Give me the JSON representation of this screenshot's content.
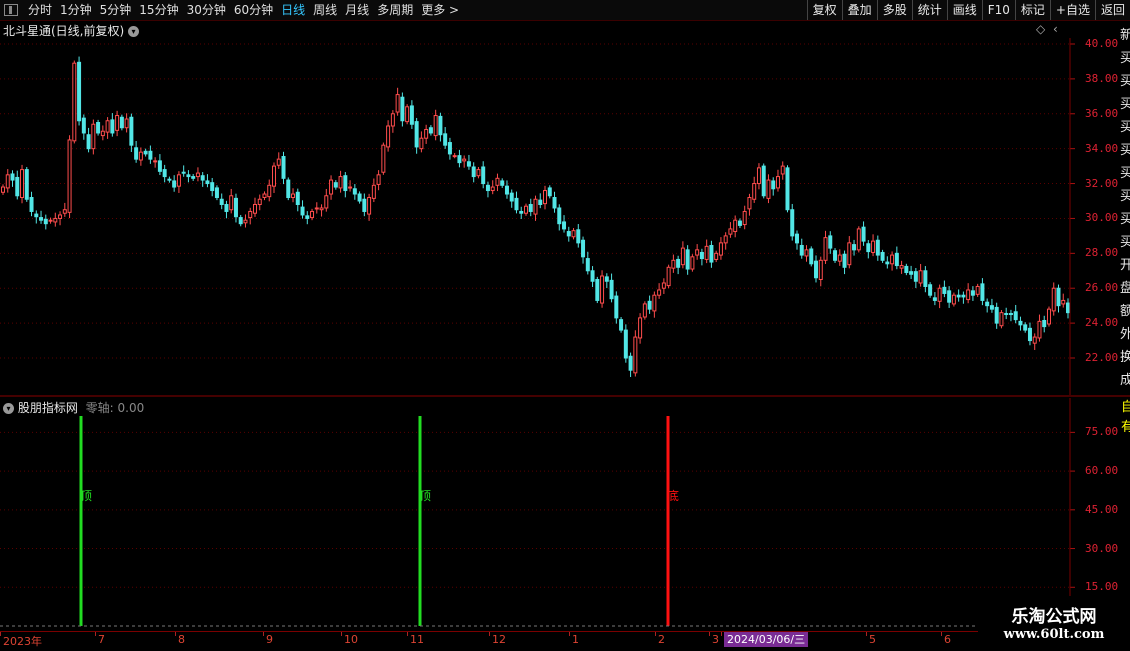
{
  "toolbar": {
    "periods": [
      "分时",
      "1分钟",
      "5分钟",
      "15分钟",
      "30分钟",
      "60分钟",
      "日线",
      "周线",
      "月线",
      "多周期",
      "更多 >"
    ],
    "active_period": "日线",
    "right_buttons": [
      "复权",
      "叠加",
      "多股",
      "统计",
      "画线",
      "F10",
      "标记",
      "+自选",
      "返回"
    ]
  },
  "main_chart": {
    "title": "北斗星通(日线,前复权)",
    "y_ticks": [
      "40.00",
      "38.00",
      "36.00",
      "34.00",
      "32.00",
      "30.00",
      "28.00",
      "26.00",
      "24.00",
      "22.00"
    ]
  },
  "indicator": {
    "title": "股朋指标网",
    "zero_axis": "零轴: 0.00",
    "y_ticks": [
      "75.00",
      "60.00",
      "45.00",
      "30.00",
      "15.00"
    ],
    "signals": [
      {
        "label": "顶",
        "color": "#22dd22"
      },
      {
        "label": "顶",
        "color": "#22dd22"
      },
      {
        "label": "底",
        "color": "#ff1111"
      }
    ]
  },
  "date_axis": {
    "labels": [
      "2023年",
      "7",
      "8",
      "9",
      "10",
      "11",
      "12",
      "1",
      "2",
      "3",
      "2024/03/06/三",
      "5",
      "6"
    ],
    "highlight": "2024/03/06/三"
  },
  "watermark": {
    "title": "乐淘公式网",
    "url": "www.60lt.com"
  },
  "side_panel_text": "新\n买\n买\n买\n买\n买\n买\n买\n买\n买\n开\n盘\n额\n外\n换\n成",
  "side_panel_text2": "自\n有",
  "chart_data": {
    "type": "candlestick",
    "title": "北斗星通(日线,前复权)",
    "ylim": [
      20.5,
      40.5
    ],
    "up_color": "#ff4d4d",
    "down_color": "#52e6e6",
    "closes": [
      31.8,
      32.5,
      32.2,
      31.3,
      32.8,
      31.1,
      30.4,
      30.1,
      29.9,
      29.7,
      29.9,
      30.0,
      30.2,
      30.5,
      34.5,
      38.9,
      35.6,
      34.9,
      34.0,
      35.4,
      34.9,
      35.0,
      35.6,
      34.9,
      35.9,
      35.2,
      35.7,
      34.2,
      33.4,
      33.8,
      33.7,
      33.4,
      33.3,
      32.7,
      32.4,
      32.2,
      31.8,
      32.5,
      32.6,
      32.4,
      32.3,
      32.6,
      32.2,
      32.0,
      31.6,
      31.2,
      30.8,
      30.4,
      31.3,
      30.1,
      29.7,
      29.9,
      30.4,
      30.8,
      31.1,
      31.4,
      31.9,
      33.0,
      33.4,
      32.3,
      31.2,
      31.4,
      30.8,
      30.2,
      30.0,
      30.4,
      30.6,
      30.6,
      31.3,
      32.2,
      31.8,
      32.4,
      31.6,
      31.8,
      31.4,
      31.0,
      30.4,
      31.2,
      31.9,
      32.5,
      34.2,
      35.3,
      36.0,
      37.1,
      35.6,
      36.4,
      35.4,
      34.1,
      34.6,
      35.1,
      34.9,
      35.9,
      34.8,
      34.2,
      33.7,
      33.6,
      33.2,
      33.4,
      33.0,
      32.4,
      32.8,
      32.0,
      31.6,
      31.8,
      32.3,
      31.9,
      31.4,
      31.0,
      30.5,
      30.3,
      30.7,
      30.4,
      31.1,
      30.8,
      31.6,
      31.3,
      30.6,
      29.7,
      29.4,
      29.0,
      29.3,
      28.6,
      27.8,
      27.0,
      26.4,
      25.3,
      26.7,
      26.4,
      25.4,
      24.3,
      23.6,
      22.0,
      21.3,
      23.2,
      24.3,
      25.1,
      24.8,
      25.6,
      25.9,
      26.3,
      27.2,
      27.6,
      27.2,
      28.3,
      27.1,
      27.8,
      28.2,
      27.7,
      28.4,
      27.5,
      28.0,
      28.6,
      29.0,
      29.4,
      29.9,
      29.6,
      30.4,
      31.2,
      32.0,
      32.9,
      31.3,
      32.2,
      31.7,
      32.4,
      33.0,
      30.5,
      29.0,
      28.6,
      27.9,
      28.2,
      27.4,
      26.6,
      27.6,
      28.9,
      28.3,
      27.6,
      27.9,
      27.2,
      28.6,
      28.2,
      29.4,
      28.7,
      28.1,
      28.7,
      27.9,
      27.6,
      27.4,
      27.9,
      27.3,
      27.3,
      26.9,
      26.8,
      26.4,
      27.0,
      26.1,
      25.6,
      25.3,
      26.0,
      25.7,
      25.2,
      25.6,
      25.5,
      25.5,
      25.9,
      25.6,
      26.1,
      25.3,
      25.0,
      24.8,
      24.0,
      24.6,
      24.5,
      24.5,
      24.2,
      23.9,
      23.6,
      23.0,
      23.2,
      24.1,
      23.8,
      24.8,
      26.0,
      25.0,
      25.3,
      24.6
    ]
  }
}
